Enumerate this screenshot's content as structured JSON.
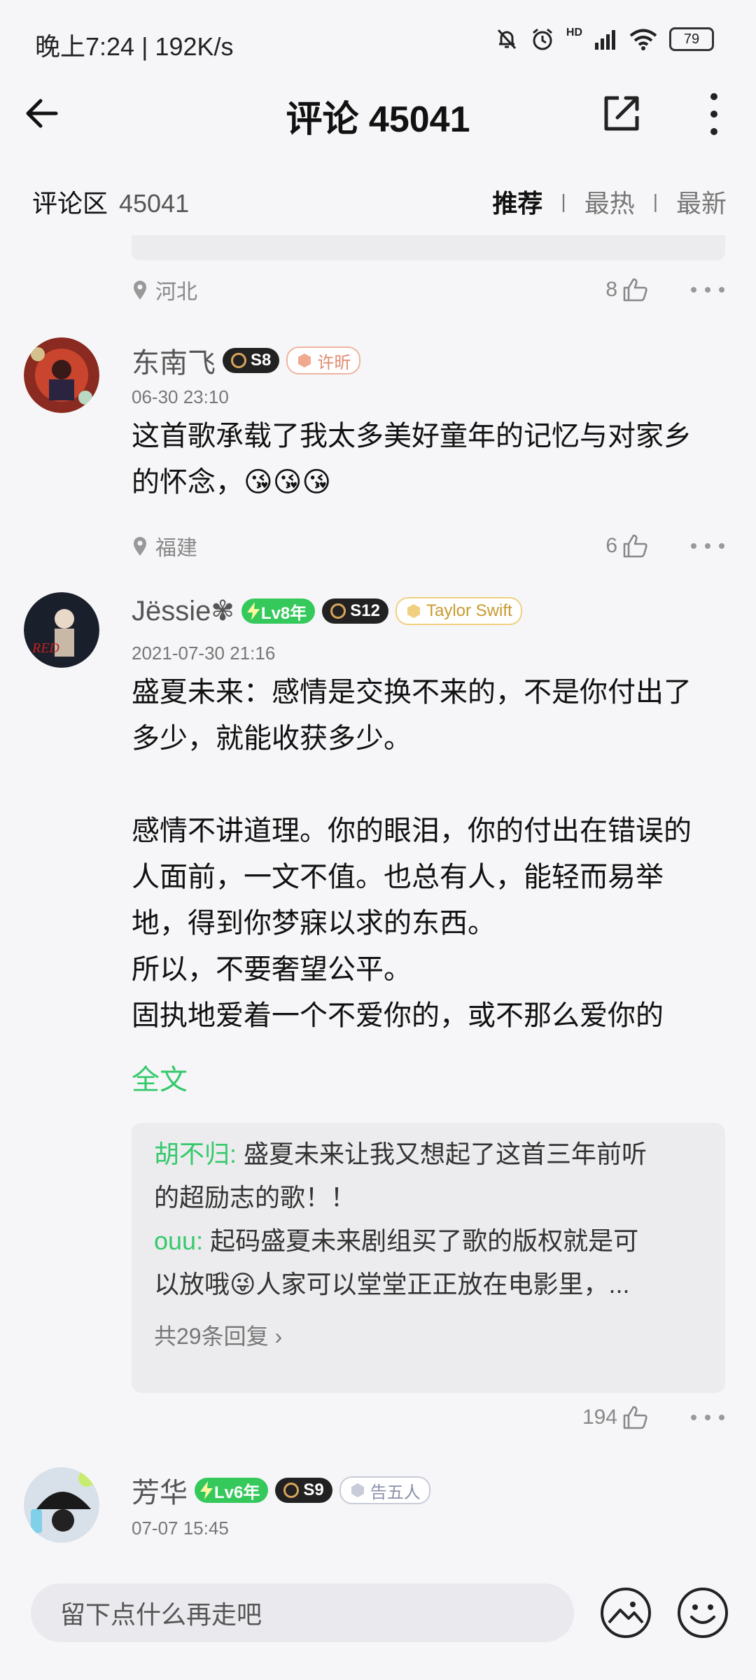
{
  "status_bar": {
    "time": "晚上7:24 | 192K/s",
    "network_label": "HD",
    "battery": "79"
  },
  "header": {
    "title": "评论 45041"
  },
  "section": {
    "title": "评论区",
    "count": "45041",
    "sort_options": [
      "推荐",
      "最热",
      "最新"
    ],
    "separator": "|"
  },
  "comments": [
    {
      "location": "河北",
      "likes": "8"
    },
    {
      "username": "东南飞",
      "badge_s": "S8",
      "tag": "许昕",
      "time": "06-30 23:10",
      "text_lines": [
        "这首歌承载了我太多美好童年的记忆与对家乡",
        "的怀念，😘😘😘"
      ],
      "location": "福建",
      "likes": "6"
    },
    {
      "username": "Jëssie✾",
      "level": "Lv8年",
      "badge_s": "S12",
      "tag": "Taylor Swift",
      "avatar_text": "RED",
      "time": "2021-07-30 21:16",
      "text_lines": [
        "盛夏未来：感情是交换不来的，不是你付出了",
        "多少，就能收获多少。",
        "",
        "感情不讲道理。你的眼泪，你的付出在错误的",
        "人面前，一文不值。也总有人，能轻而易举",
        "地，得到你梦寐以求的东西。",
        "所以，不要奢望公平。",
        "固执地爱着一个不爱你的，或不那么爱你的"
      ],
      "full_text_label": "全文",
      "replies": [
        {
          "who": "胡不归:",
          "lines": [
            " 盛夏未来让我又想起了这首三年前听",
            "的超励志的歌！！"
          ]
        },
        {
          "who": "ouu:",
          "lines": [
            " 起码盛夏未来剧组买了歌的版权就是可",
            "以放哦😜人家可以堂堂正正放在电影里，..."
          ]
        }
      ],
      "reply_more": "共29条回复 ›",
      "likes": "194"
    },
    {
      "username": "芳华",
      "level": "Lv6年",
      "badge_s": "S9",
      "tag": "告五人",
      "time": "07-07 15:45"
    }
  ],
  "input": {
    "placeholder": "留下点什么再走吧"
  },
  "colors": {
    "accent_green": "#35c96c",
    "background": "#f6f6f8"
  }
}
